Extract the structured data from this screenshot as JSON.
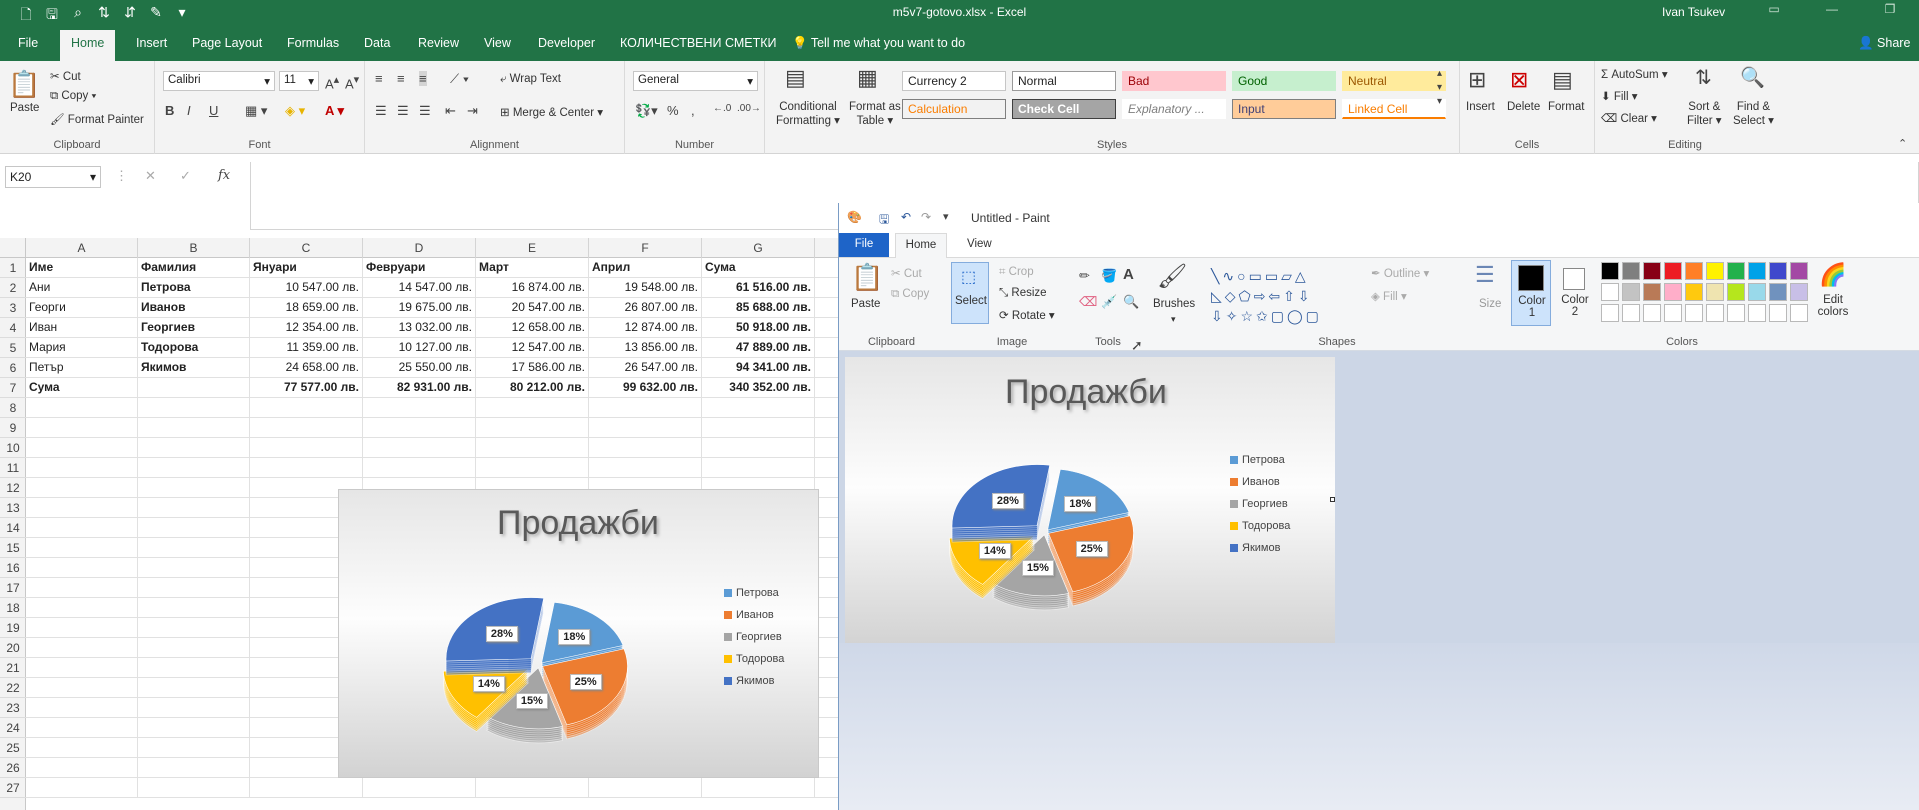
{
  "excel": {
    "title": "m5v7-gotovo.xlsx - Excel",
    "user": "Ivan Tsukev",
    "tabs": [
      "File",
      "Home",
      "Insert",
      "Page Layout",
      "Formulas",
      "Data",
      "Review",
      "View",
      "Developer",
      "КОЛИЧЕСТВЕНИ СМЕТКИ"
    ],
    "tell_me": "Tell me what you want to do",
    "share": "Share",
    "ribbon": {
      "clipboard": {
        "paste": "Paste",
        "cut": "Cut",
        "copy": "Copy",
        "format_painter": "Format Painter",
        "label": "Clipboard"
      },
      "font": {
        "name": "Calibri",
        "size": "11",
        "label": "Font",
        "bold": "B",
        "italic": "I",
        "underline": "U"
      },
      "alignment": {
        "wrap": "Wrap Text",
        "merge": "Merge & Center",
        "label": "Alignment"
      },
      "number": {
        "format": "General",
        "label": "Number",
        "pct": "%",
        "comma": ","
      },
      "styles": {
        "cond1": "Conditional",
        "cond2": "Formatting",
        "fmt1": "Format as",
        "fmt2": "Table",
        "label": "Styles",
        "cells": [
          {
            "text": "Currency 2",
            "bg": "#ffffff",
            "fg": "#222",
            "border": "#c6c6c6"
          },
          {
            "text": "Normal",
            "bg": "#ffffff",
            "fg": "#222",
            "border": "#9a9a9a"
          },
          {
            "text": "Bad",
            "bg": "#ffc7ce",
            "fg": "#9c0006",
            "border": "#ffc7ce"
          },
          {
            "text": "Good",
            "bg": "#c6efce",
            "fg": "#006100",
            "border": "#c6efce"
          },
          {
            "text": "Neutral",
            "bg": "#ffeb9c",
            "fg": "#9c5700",
            "border": "#ffeb9c"
          },
          {
            "text": "Calculation",
            "bg": "#f2f2f2",
            "fg": "#fa7d00",
            "border": "#7f7f7f"
          },
          {
            "text": "Check Cell",
            "bg": "#a5a5a5",
            "fg": "#ffffff",
            "border": "#3f3f3f"
          },
          {
            "text": "Explanatory ...",
            "bg": "#ffffff",
            "fg": "#7f7f7f",
            "border": "#ffffff"
          },
          {
            "text": "Input",
            "bg": "#ffcc99",
            "fg": "#3f3f76",
            "border": "#7f7f7f"
          },
          {
            "text": "Linked Cell",
            "bg": "#ffffff",
            "fg": "#fa7d00",
            "border": "#ffffff"
          }
        ]
      },
      "cells_grp": {
        "insert": "Insert",
        "delete": "Delete",
        "format": "Format",
        "label": "Cells"
      },
      "editing": {
        "autosum": "AutoSum",
        "fill": "Fill",
        "clear": "Clear",
        "sort1": "Sort &",
        "sort2": "Filter",
        "find1": "Find &",
        "find2": "Select",
        "label": "Editing"
      }
    },
    "name_box": "K20",
    "fx": "fx",
    "columns": [
      "A",
      "B",
      "C",
      "D",
      "E",
      "F",
      "G"
    ],
    "rows": [
      "1",
      "2",
      "3",
      "4",
      "5",
      "6",
      "7",
      "8",
      "9",
      "10",
      "11",
      "12",
      "13",
      "14",
      "15",
      "16",
      "17",
      "18",
      "19",
      "20",
      "21",
      "22",
      "23",
      "24",
      "25",
      "26",
      "27"
    ],
    "table": [
      [
        "Име",
        "Фамилия",
        "Януари",
        "Февруари",
        "Март",
        "Април",
        "Сума"
      ],
      [
        "Ани",
        "Петрова",
        "10 547.00 лв.",
        "14 547.00 лв.",
        "16 874.00 лв.",
        "19 548.00 лв.",
        "61 516.00 лв."
      ],
      [
        "Георги",
        "Иванов",
        "18 659.00 лв.",
        "19 675.00 лв.",
        "20 547.00 лв.",
        "26 807.00 лв.",
        "85 688.00 лв."
      ],
      [
        "Иван",
        "Георгиев",
        "12 354.00 лв.",
        "13 032.00 лв.",
        "12 658.00 лв.",
        "12 874.00 лв.",
        "50 918.00 лв."
      ],
      [
        "Мария",
        "Тодорова",
        "11 359.00 лв.",
        "10 127.00 лв.",
        "12 547.00 лв.",
        "13 856.00 лв.",
        "47 889.00 лв."
      ],
      [
        "Петър",
        "Якимов",
        "24 658.00 лв.",
        "25 550.00 лв.",
        "17 586.00 лв.",
        "26 547.00 лв.",
        "94 341.00 лв."
      ],
      [
        "Сума",
        "",
        "77 577.00 лв.",
        "82 931.00 лв.",
        "80 212.00 лв.",
        "99 632.00 лв.",
        "340 352.00 лв."
      ]
    ]
  },
  "chart_data": {
    "type": "pie",
    "title": "Продажби",
    "categories": [
      "Петрова",
      "Иванов",
      "Георгиев",
      "Тодорова",
      "Якимов"
    ],
    "values": [
      18,
      25,
      15,
      14,
      28
    ],
    "labels": [
      "18%",
      "25%",
      "15%",
      "14%",
      "28%"
    ],
    "colors": [
      "#5b9bd5",
      "#ed7d31",
      "#a5a5a5",
      "#ffc000",
      "#4472c4"
    ],
    "legend": "right"
  },
  "paint": {
    "title": "Untitled - Paint",
    "tabs": [
      "File",
      "Home",
      "View"
    ],
    "clipboard": {
      "paste": "Paste",
      "cut": "Cut",
      "copy": "Copy",
      "label": "Clipboard"
    },
    "image": {
      "select": "Select",
      "crop": "Crop",
      "resize": "Resize",
      "rotate": "Rotate",
      "label": "Image"
    },
    "tools": {
      "label": "Tools"
    },
    "brushes": "Brushes",
    "shapes": {
      "outline": "Outline",
      "fill": "Fill",
      "label": "Shapes"
    },
    "size": "Size",
    "color1": "Color 1",
    "color2": "Color 2",
    "colors_label": "Colors",
    "edit_colors": "Edit colors",
    "palette": [
      "#000000",
      "#7f7f7f",
      "#880015",
      "#ed1c24",
      "#ff7f27",
      "#fff200",
      "#22b14c",
      "#00a2e8",
      "#3f48cc",
      "#a349a4",
      "#ffffff",
      "#c3c3c3",
      "#b97a57",
      "#ffaec9",
      "#ffc90e",
      "#efe4b0",
      "#b5e61d",
      "#99d9ea",
      "#7092be",
      "#c8bfe7"
    ]
  }
}
